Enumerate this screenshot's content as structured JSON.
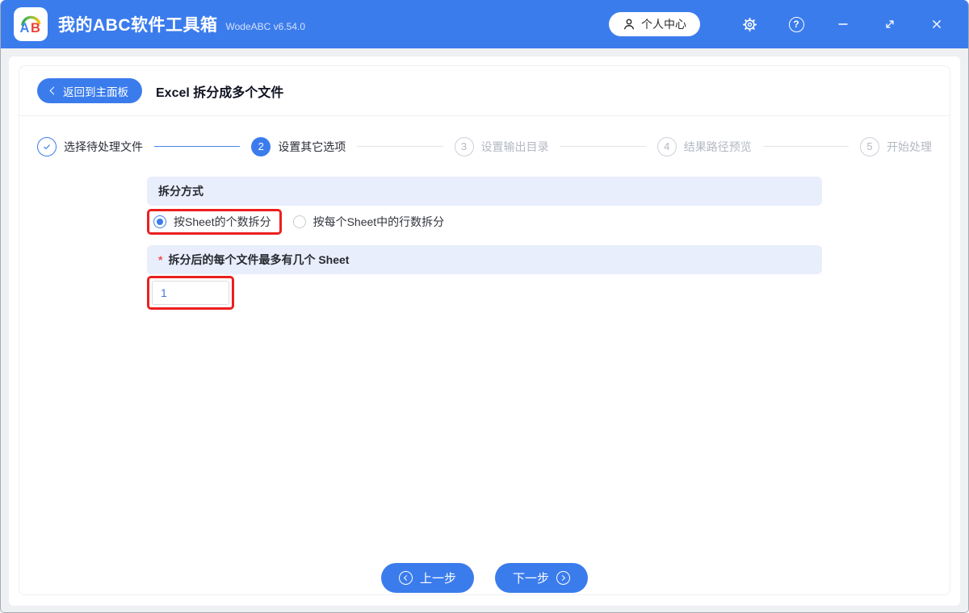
{
  "window": {
    "app_title": "我的ABC软件工具箱",
    "app_version": "WodeABC v6.54.0",
    "user_center_label": "个人中心",
    "help_glyph": "?"
  },
  "toolbar": {
    "back_label": "返回到主面板",
    "page_title": "Excel 拆分成多个文件"
  },
  "steps": [
    {
      "num": "",
      "label": "选择待处理文件",
      "state": "done"
    },
    {
      "num": "2",
      "label": "设置其它选项",
      "state": "active"
    },
    {
      "num": "3",
      "label": "设置输出目录",
      "state": "pending"
    },
    {
      "num": "4",
      "label": "结果路径预览",
      "state": "pending"
    },
    {
      "num": "5",
      "label": "开始处理",
      "state": "pending"
    }
  ],
  "form": {
    "split_mode_title": "拆分方式",
    "radio_by_sheet_count": "按Sheet的个数拆分",
    "radio_by_rows": "按每个Sheet中的行数拆分",
    "selected_radio": "按Sheet的个数拆分",
    "required_mark": "*",
    "sheet_limit_title": "拆分后的每个文件最多有几个 Sheet",
    "sheet_limit_value": "1"
  },
  "footer": {
    "prev_label": "上一步",
    "next_label": "下一步"
  },
  "colors": {
    "accent_blue": "#3b7ced",
    "section_bg": "#e8eefc",
    "annotation_red": "#ec1f1f",
    "input_value_blue": "#4478e0",
    "pending_gray": "#b3b8c2"
  }
}
